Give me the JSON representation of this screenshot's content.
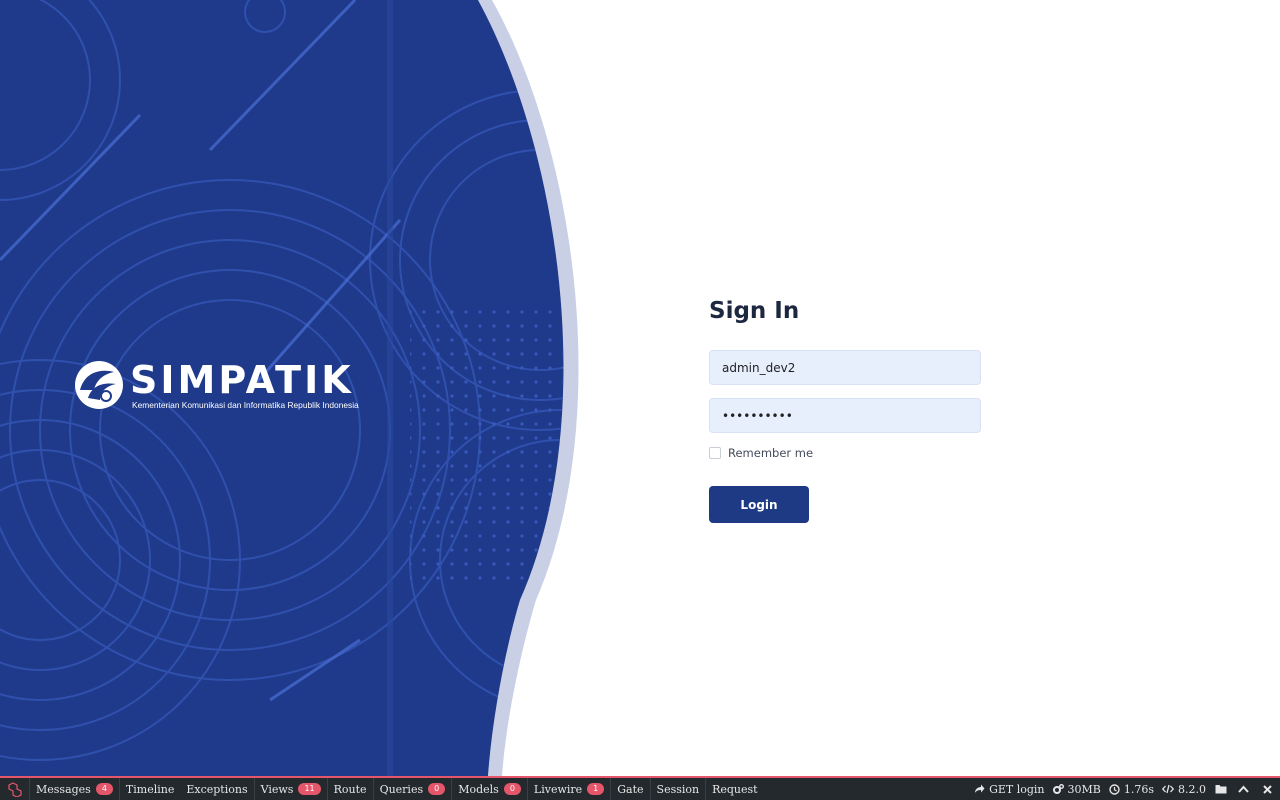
{
  "brand": {
    "name": "SIMPATIK",
    "subtitle": "Kementerian Komunikasi dan Informatika Republik Indonesia"
  },
  "form": {
    "title": "Sign In",
    "username_value": "admin_dev2",
    "password_value": "••••••••••",
    "remember_label": "Remember me",
    "remember_checked": false,
    "login_label": "Login"
  },
  "debugbar": {
    "tabs": [
      {
        "label": "Messages",
        "badge": "4"
      },
      {
        "label": "Timeline"
      },
      {
        "label": "Exceptions"
      },
      {
        "label": "Views",
        "badge": "11"
      },
      {
        "label": "Route"
      },
      {
        "label": "Queries",
        "badge": "0"
      },
      {
        "label": "Models",
        "badge": "0"
      },
      {
        "label": "Livewire",
        "badge": "1"
      },
      {
        "label": "Gate"
      },
      {
        "label": "Session"
      },
      {
        "label": "Request"
      }
    ],
    "route": "GET login",
    "memory": "30MB",
    "duration": "1.76s",
    "php_version": "8.2.0",
    "accent_color": "#e5566a"
  },
  "colors": {
    "hero_blue": "#1f3a8a",
    "button_blue": "#1f3a85",
    "input_bg": "#e8effc"
  },
  "icons": [
    "laravel-icon",
    "share-icon",
    "gears-icon",
    "clock-icon",
    "code-icon",
    "folder-icon",
    "chevron-up-icon",
    "close-icon"
  ]
}
